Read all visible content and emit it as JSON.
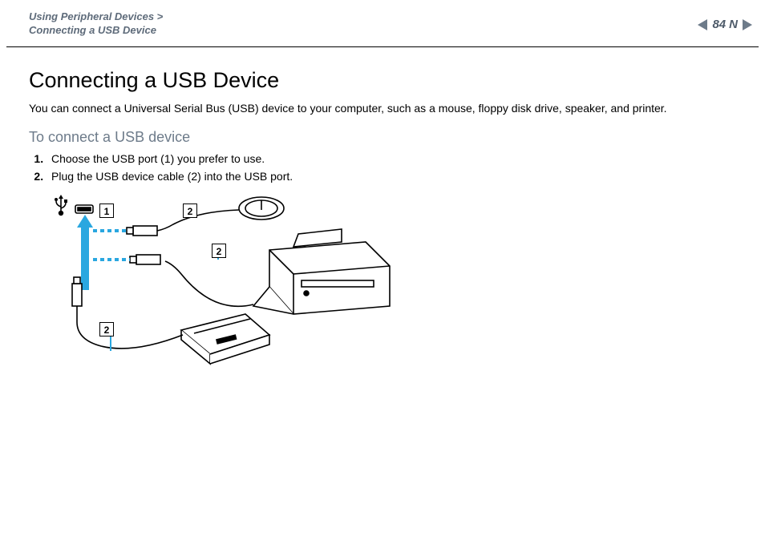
{
  "header": {
    "breadcrumb_line1": "Using Peripheral Devices >",
    "breadcrumb_line2": "Connecting a USB Device",
    "page_number": "84"
  },
  "body": {
    "title": "Connecting a USB Device",
    "intro": "You can connect a Universal Serial Bus (USB) device to your computer, such as a mouse, floppy disk drive, speaker, and printer.",
    "subhead": "To connect a USB device",
    "steps": [
      "Choose the USB port (1) you prefer to use.",
      "Plug the USB device cable (2) into the USB port."
    ]
  },
  "diagram": {
    "callouts": {
      "port": "1",
      "mouse_cable": "2",
      "printer_cable": "2",
      "floppy_cable": "2"
    }
  }
}
